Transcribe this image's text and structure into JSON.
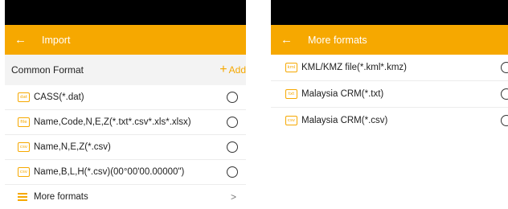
{
  "colors": {
    "accent": "#f6a800",
    "status_bar": "#000000",
    "section_bg": "#f3f3f3"
  },
  "left": {
    "title": "Import",
    "section_title": "Common Format",
    "add_label": "Add",
    "items": [
      {
        "badge": "dat",
        "label": "CASS(*.dat)"
      },
      {
        "badge": "file",
        "label": "Name,Code,N,E,Z(*.txt*.csv*.xls*.xlsx)"
      },
      {
        "badge": "csv",
        "label": "Name,N,E,Z(*.csv)"
      },
      {
        "badge": "csv",
        "label": "Name,B,L,H(*.csv)(00°00'00.00000\")"
      }
    ],
    "more_formats": "More formats"
  },
  "right": {
    "title": "More formats",
    "items": [
      {
        "badge": "kml",
        "label": "KML/KMZ file(*.kml*.kmz)"
      },
      {
        "badge": "txt",
        "label": "Malaysia CRM(*.txt)"
      },
      {
        "badge": "csv",
        "label": "Malaysia CRM(*.csv)"
      }
    ]
  }
}
